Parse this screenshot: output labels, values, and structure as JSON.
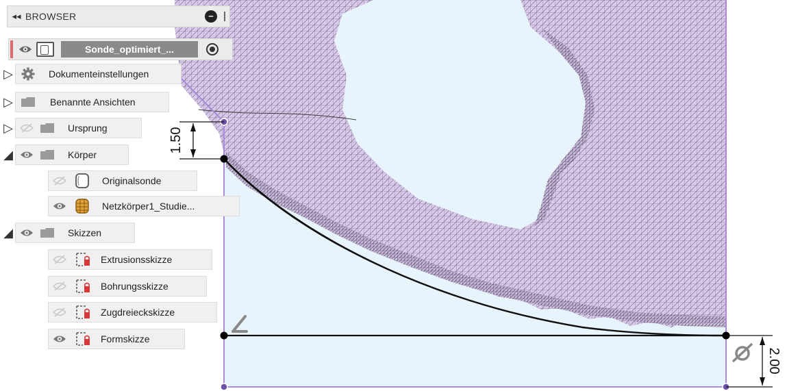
{
  "browser": {
    "title": "BROWSER",
    "collapse_glyph": "◂◂",
    "root": {
      "name": "Sonde_optimiert_..."
    },
    "items": [
      {
        "label": "Dokumenteinstellungen",
        "twisty": "▷",
        "icon": "gear-icon"
      },
      {
        "label": "Benannte Ansichten",
        "twisty": "▷",
        "icon": "folder-icon"
      },
      {
        "label": "Ursprung",
        "twisty": "▷",
        "icon": "folder-icon",
        "eye": "hidden"
      },
      {
        "label": "Körper",
        "twisty": "◢",
        "icon": "folder-icon",
        "eye": "visible"
      },
      {
        "label": "Originalsonde",
        "icon": "body-icon",
        "eye": "hidden"
      },
      {
        "label": "Netzkörper1_Studie...",
        "icon": "mesh-body-icon",
        "eye": "visible"
      },
      {
        "label": "Skizzen",
        "twisty": "◢",
        "icon": "folder-icon",
        "eye": "visible"
      },
      {
        "label": "Extrusionsskizze",
        "icon": "sketch-icon",
        "eye": "hidden"
      },
      {
        "label": "Bohrungsskizze",
        "icon": "sketch-icon",
        "eye": "hidden"
      },
      {
        "label": "Zugdreieckskizze",
        "icon": "sketch-icon",
        "eye": "hidden"
      },
      {
        "label": "Formskizze",
        "icon": "sketch-icon",
        "eye": "visible"
      }
    ]
  },
  "dimensions": {
    "vertical_top": "1.50",
    "vertical_bottom": "2.00"
  },
  "colors": {
    "mesh_fill": "#d8c8ec",
    "mesh_line": "#3a3a3a",
    "sketch_profile": "#e8f4fb",
    "sketch_edge": "#a88ad8",
    "accent_red": "#e06a6a"
  }
}
